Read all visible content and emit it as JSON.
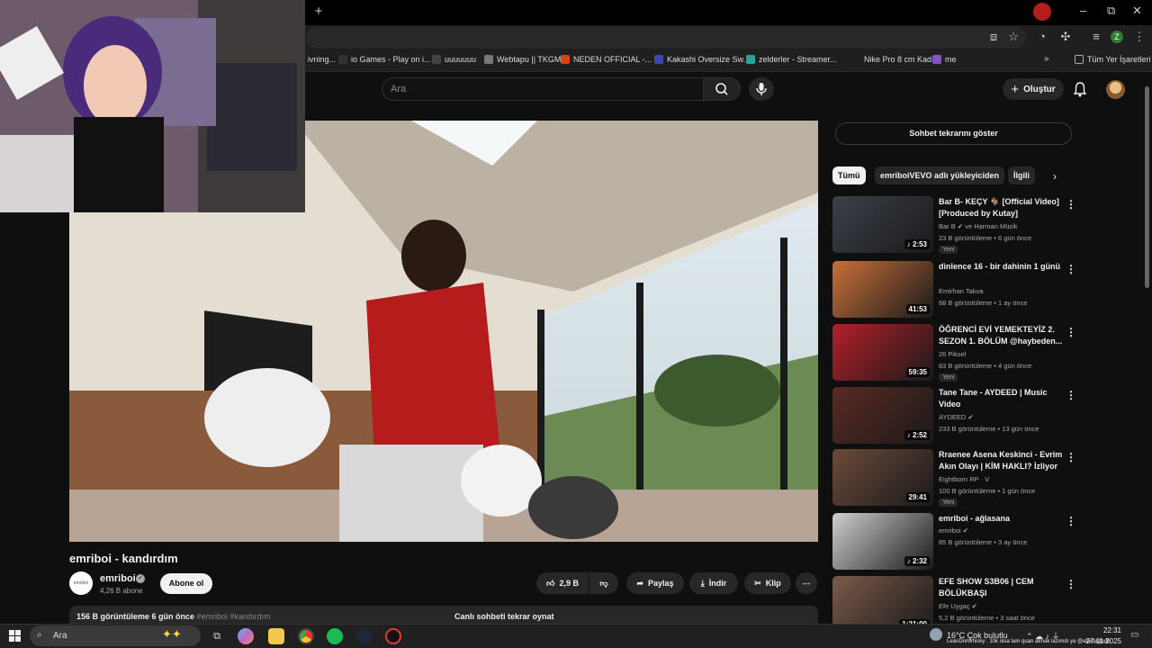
{
  "browser": {
    "bookmarks": [
      {
        "label": "ivning...",
        "color": "#555555",
        "icon": "bookmark-icon"
      },
      {
        "label": "io Games - Play on i...",
        "color": "#333333",
        "icon": "controller-icon"
      },
      {
        "label": "uuuuuuu",
        "color": "#444444",
        "icon": "github-icon"
      },
      {
        "label": "Webtapu || TKGM",
        "color": "#777777",
        "icon": "leaf-icon"
      },
      {
        "label": "NEDEN OFFICIAL -...",
        "color": "#d84315",
        "icon": "circle-icon"
      },
      {
        "label": "Kakashi Oversize Sw...",
        "color": "#3949ab",
        "icon": "s-icon"
      },
      {
        "label": "zelderler - Streamer...",
        "color": "#26a69a",
        "icon": "tt-icon"
      },
      {
        "label": "Nike Pro 8 cm Kadı...",
        "color": "#1f1f1f",
        "icon": "blank-icon"
      },
      {
        "label": "me",
        "color": "#7e57c2",
        "icon": "twitch-icon"
      }
    ],
    "all_bookmarks": "Tüm Yer İşaretleri",
    "profile_letter": "Z"
  },
  "youtube": {
    "search_placeholder": "Ara",
    "create_label": "Oluştur",
    "video": {
      "title": "emriboi - kandırdım",
      "channel": "emriboi",
      "channel_avatar_text": "emriboi",
      "subscribers": "4,26 B abone",
      "subscribe_label": "Abone ol",
      "likes": "2,9 B",
      "share_label": "Paylaş",
      "download_label": "İndir",
      "clip_label": "Klip",
      "desc_stats": "156 B görüntüleme  6 gün önce",
      "desc_tags": "#emriboi #kandırdım",
      "chat_replay_label": "Canlı sohbeti tekrar oynat"
    },
    "sidebar": {
      "show_chat": "Sohbet tekrarını göster",
      "chips": [
        "Tümü",
        "emriboiVEVO adlı yükleyiciden",
        "İlgili"
      ],
      "recommendations": [
        {
          "title": "Bar B- KEÇY 🐐 [Official Video] [Produced by Kutay]",
          "channel": "Bar B ✔ ve Harman Müzik",
          "meta": "23 B görüntüleme • 6 gün önce",
          "new": "Yeni",
          "duration": "♪ 2:53",
          "thumb": "#3b4048"
        },
        {
          "title": "dinlence 16 - bir dahinin 1 günü",
          "channel": "Emirhan Takva",
          "meta": "68 B görüntüleme • 1 ay önce",
          "new": "",
          "duration": "41:53",
          "thumb": "#c9703a"
        },
        {
          "title": "ÖĞRENCİ EVİ YEMEKTEYİZ 2. SEZON 1. BÖLÜM @haybeden...",
          "channel": "26 Piksel",
          "meta": "83 B görüntüleme • 4 gün önce",
          "new": "Yeni",
          "duration": "59:35",
          "thumb": "#b3202a"
        },
        {
          "title": "Tane Tane - AYDEED | Music Video",
          "channel": "AYDEED ✔",
          "meta": "233 B görüntüleme • 13 gün önce",
          "new": "",
          "duration": "♪ 2:52",
          "thumb": "#5a2a24"
        },
        {
          "title": "Rraenee Asena Keskinci - Evrim Akın Olayı | KİM HAKLI? İzliyor",
          "channel": "Eightborn RP · V",
          "meta": "100 B görüntüleme • 1 gün önce",
          "new": "Yeni",
          "duration": "29:41",
          "thumb": "#6b4a3a"
        },
        {
          "title": "emriboi - ağlasana",
          "channel": "emriboi ✔",
          "meta": "85 B görüntüleme • 3 ay önce",
          "new": "",
          "duration": "♪ 2:32",
          "thumb": "#cfcfcf"
        },
        {
          "title": "EFE SHOW S3B06 | CEM BÖLÜKBAŞI",
          "channel": "Efe Uygaç ✔",
          "meta": "5,2 B görüntüleme • 3 saat önce",
          "new": "",
          "duration": "1:21:00",
          "thumb": "#7a5a4a"
        }
      ]
    }
  },
  "taskbar": {
    "search_label": "Ara",
    "weather": "16°C  Çok bulutlu",
    "ticker": "LeanDreWhisky : 10k olsa tam quan atmak lazımdı ya @askdaijtedk",
    "time": "22:31",
    "date": "27.11.2025"
  }
}
